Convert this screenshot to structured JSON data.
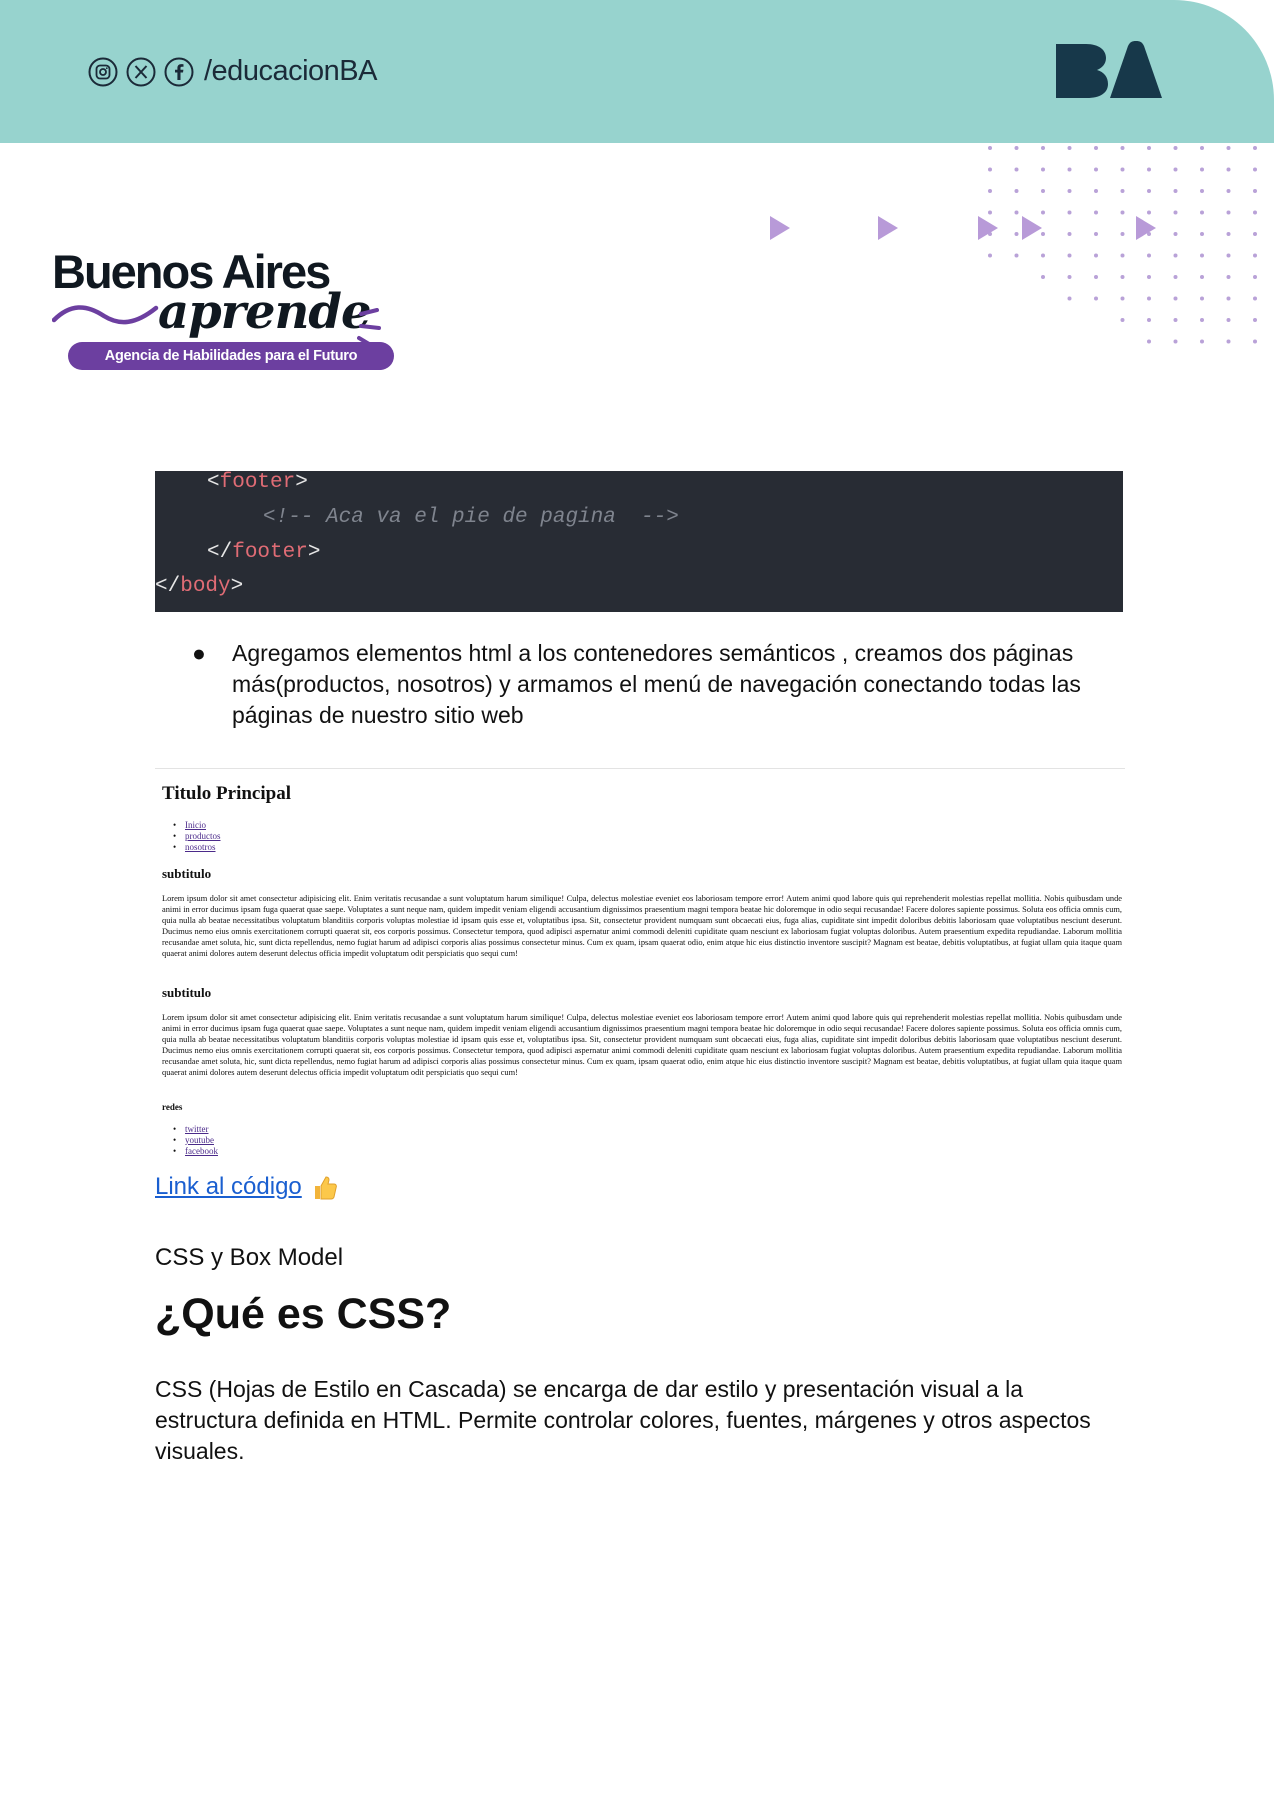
{
  "header": {
    "handle": "/educacionBA",
    "icons": [
      "instagram-icon",
      "x-icon",
      "facebook-icon"
    ],
    "ba_logo": "BA",
    "colors": {
      "band": "#97d3ce",
      "logo": "#17384a"
    }
  },
  "brand": {
    "line1": "Buenos Aires",
    "line2": "aprende",
    "tagline": "Agencia de Habilidades para el Futuro",
    "colors": {
      "pill": "#6c3fa0",
      "accent": "#6c3fa0"
    }
  },
  "code_block": {
    "lines": [
      {
        "open": "<",
        "tag": "footer",
        "close": ">"
      },
      {
        "comment": "<!-- Aca va el pie de pagina  -->"
      },
      {
        "open": "</",
        "tag": "footer",
        "close": ">"
      },
      {
        "open": "</",
        "tag": "body",
        "close": ">"
      }
    ]
  },
  "bullet": {
    "marker": "●",
    "text": "Agregamos  elementos html a los contenedores semánticos , creamos dos páginas más(productos, nosotros)  y armamos el menú de navegación conectando todas las páginas de nuestro sitio web"
  },
  "screenshot": {
    "title": "Titulo Principal",
    "nav": [
      "Inicio",
      "productos",
      "nosotros"
    ],
    "sections": [
      {
        "heading": "subtitulo",
        "body": "Lorem ipsum dolor sit amet consectetur adipisicing elit. Enim veritatis recusandae a sunt voluptatum harum similique! Culpa, delectus molestiae eveniet eos laboriosam tempore error! Autem animi quod labore quis qui reprehenderit molestias repellat mollitia. Nobis quibusdam unde animi in error ducimus ipsam fuga quaerat quae saepe. Voluptates a sunt neque nam, quidem impedit veniam eligendi accusantium dignissimos praesentium magni tempora beatae hic doloremque in odio sequi recusandae! Facere dolores sapiente possimus. Soluta eos officia omnis cum, quia nulla ab beatae necessitatibus voluptatum blanditiis corporis voluptas molestiae id ipsam quis esse et, voluptatibus ipsa. Sit, consectetur provident numquam sunt obcaecati eius, fuga alias, cupiditate sint impedit doloribus debitis laboriosam quae voluptatibus nesciunt deserunt. Ducimus nemo eius omnis exercitationem corrupti quaerat sit, eos corporis possimus. Consectetur tempora, quod adipisci aspernatur animi commodi deleniti cupiditate quam nesciunt ex laboriosam fugiat voluptas doloribus. Autem praesentium expedita repudiandae. Laborum mollitia recusandae amet soluta, hic, sunt dicta repellendus, nemo fugiat harum ad adipisci corporis alias possimus consectetur minus. Cum ex quam, ipsam quaerat odio, enim atque hic eius distinctio inventore suscipit? Magnam est beatae, debitis voluptatibus, at fugiat ullam quia itaque quam quaerat animi dolores autem deserunt delectus officia impedit voluptatum odit perspiciatis quo sequi cum!"
      },
      {
        "heading": "subtitulo",
        "body": "Lorem ipsum dolor sit amet consectetur adipisicing elit. Enim veritatis recusandae a sunt voluptatum harum similique! Culpa, delectus molestiae eveniet eos laboriosam tempore error! Autem animi quod labore quis qui reprehenderit molestias repellat mollitia. Nobis quibusdam unde animi in error ducimus ipsam fuga quaerat quae saepe. Voluptates a sunt neque nam, quidem impedit veniam eligendi accusantium dignissimos praesentium magni tempora beatae hic doloremque in odio sequi recusandae! Facere dolores sapiente possimus. Soluta eos officia omnis cum, quia nulla ab beatae necessitatibus voluptatum blanditiis corporis voluptas molestiae id ipsam quis esse et, voluptatibus ipsa. Sit, consectetur provident numquam sunt obcaecati eius, fuga alias, cupiditate sint impedit doloribus debitis laboriosam quae voluptatibus nesciunt deserunt. Ducimus nemo eius omnis exercitationem corrupti quaerat sit, eos corporis possimus. Consectetur tempora, quod adipisci aspernatur animi commodi deleniti cupiditate quam nesciunt ex laboriosam fugiat voluptas doloribus. Autem praesentium expedita repudiandae. Laborum mollitia recusandae amet soluta, hic, sunt dicta repellendus, nemo fugiat harum ad adipisci corporis alias possimus consectetur minus. Cum ex quam, ipsam quaerat odio, enim atque hic eius distinctio inventore suscipit? Magnam est beatae, debitis voluptatibus, at fugiat ullam quia itaque quam quaerat animi dolores autem deserunt delectus officia impedit voluptatum odit perspiciatis quo sequi cum!"
      }
    ],
    "footer_heading": "redes",
    "social_links": [
      "twitter",
      "youtube",
      "facebook"
    ]
  },
  "link": {
    "text": "Link al código ",
    "emoji": "thumbs-up-icon"
  },
  "section": {
    "label": "CSS y Box Model",
    "heading": "¿Qué es CSS?",
    "paragraph": "CSS (Hojas de Estilo en Cascada) se encarga de dar estilo y presentación visual a la estructura definida en HTML. Permite controlar colores, fuentes, márgenes y otros aspectos visuales."
  }
}
